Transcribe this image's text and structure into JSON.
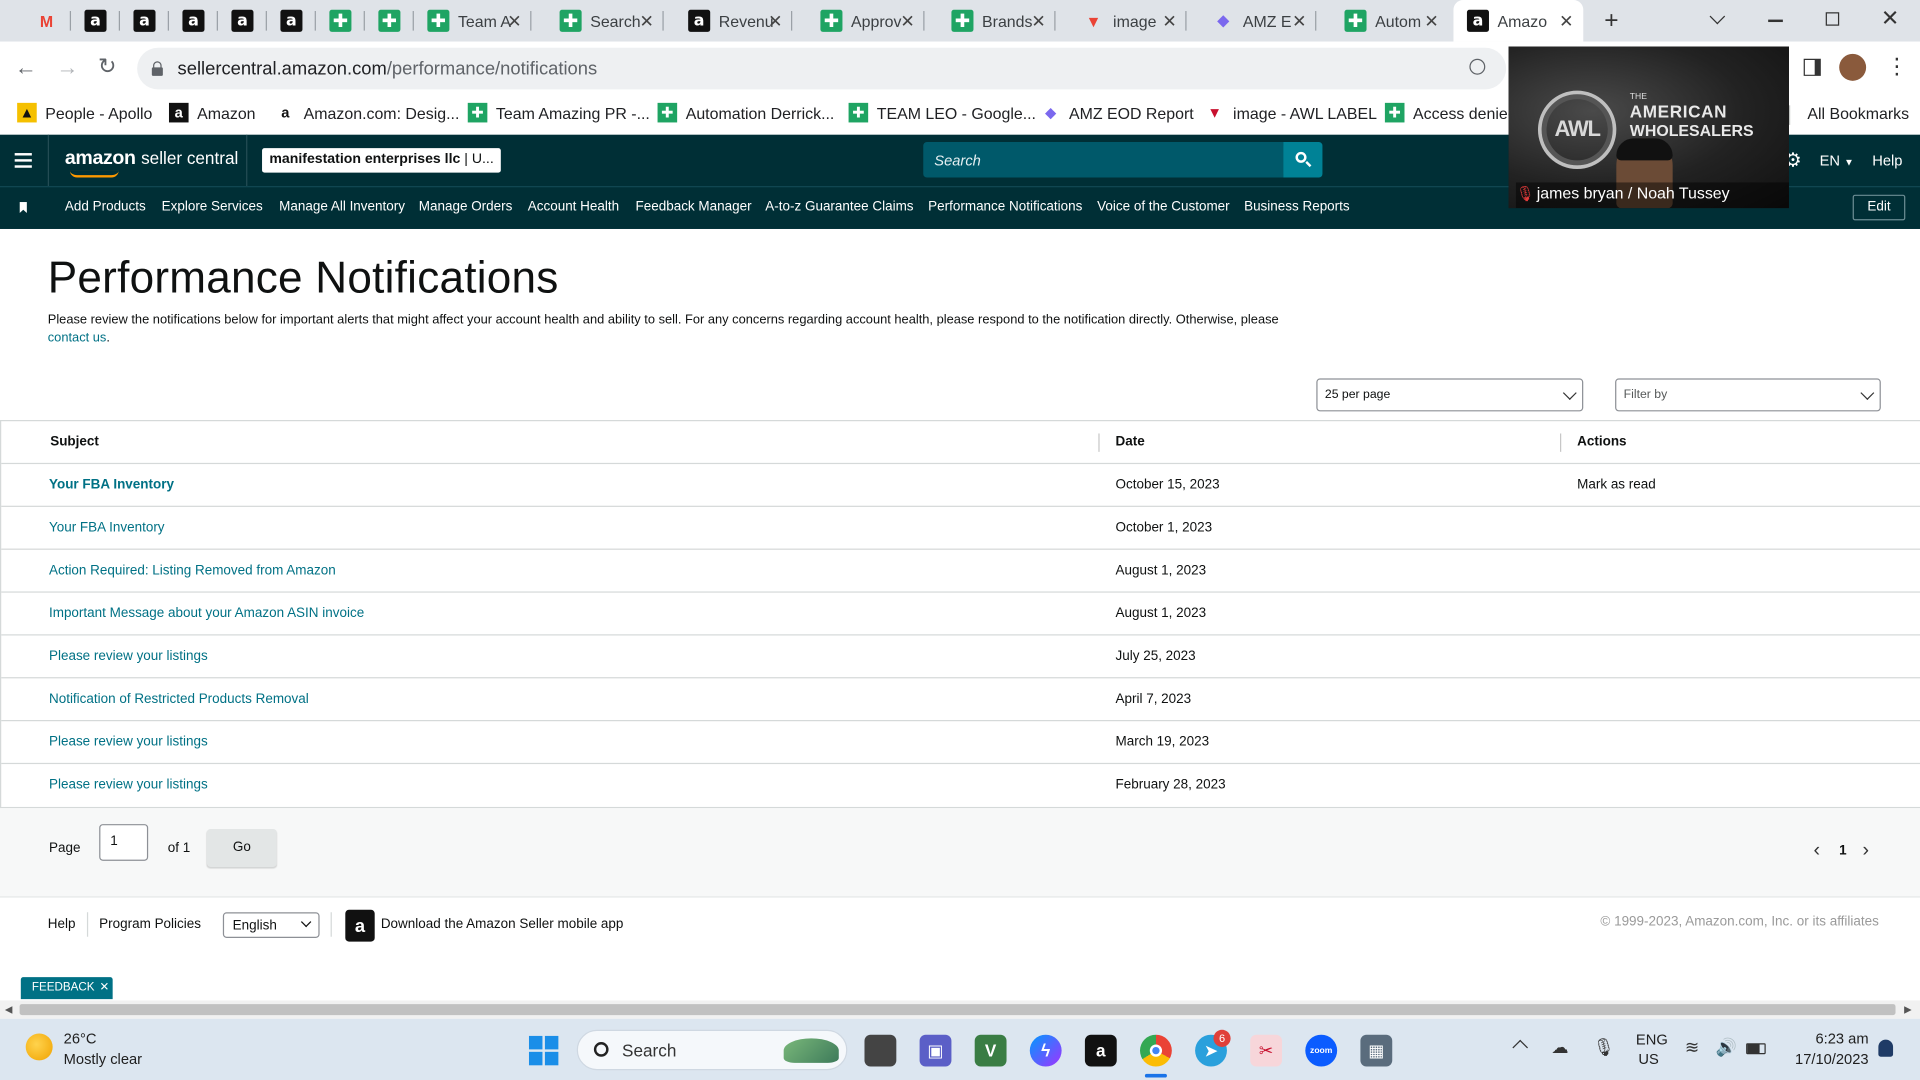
{
  "browser": {
    "tabs": [
      {
        "title": "",
        "icon": "gmail-icon"
      },
      {
        "title": "",
        "icon": "amazon-icon"
      },
      {
        "title": "",
        "icon": "amazon-icon"
      },
      {
        "title": "",
        "icon": "amazon-icon"
      },
      {
        "title": "",
        "icon": "amazon-icon"
      },
      {
        "title": "",
        "icon": "amazon-icon"
      },
      {
        "title": "",
        "icon": "sheets-icon"
      },
      {
        "title": "",
        "icon": "sheets-icon"
      },
      {
        "title": "Team A",
        "icon": "sheets-icon"
      },
      {
        "title": "Search",
        "icon": "sheets-icon"
      },
      {
        "title": "Revenu",
        "icon": "amazon-icon"
      },
      {
        "title": "Approv",
        "icon": "sheets-icon"
      },
      {
        "title": "Brands",
        "icon": "sheets-icon"
      },
      {
        "title": "image",
        "icon": "awl-icon"
      },
      {
        "title": "AMZ E",
        "icon": "clickup-icon"
      },
      {
        "title": "Autom",
        "icon": "sheets-icon"
      },
      {
        "title": "Amazo",
        "icon": "amazon-icon"
      }
    ],
    "new_tab": "+",
    "url_host": "sellercentral.amazon.com",
    "url_path": "/performance/notifications",
    "bookmarks": [
      {
        "label": "People - Apollo",
        "icon": "apollo-icon"
      },
      {
        "label": "Amazon",
        "icon": "amazon-icon"
      },
      {
        "label": "Amazon.com: Desig...",
        "icon": "amazon-smile-icon"
      },
      {
        "label": "Team Amazing PR -...",
        "icon": "sheets-icon"
      },
      {
        "label": "Automation Derrick...",
        "icon": "sheets-icon"
      },
      {
        "label": "TEAM LEO - Google...",
        "icon": "sheets-icon"
      },
      {
        "label": "AMZ EOD Report",
        "icon": "clickup-icon"
      },
      {
        "label": "image - AWL LABEL",
        "icon": "awl-icon"
      },
      {
        "label": "Access denied",
        "icon": "sheets-icon"
      }
    ],
    "all_bookmarks": "All Bookmarks"
  },
  "video": {
    "caption": "james bryan / Noah Tussey",
    "logo_the": "THE",
    "logo_line1": "AMERICAN",
    "logo_line2": "WHOLESALERS",
    "logo_mark": "AWL"
  },
  "seller_header": {
    "logo_amazon": "amazon",
    "logo_sc": "seller central",
    "account": "manifestation enterprises llc",
    "account_suffix": " | U...",
    "search_placeholder": "Search",
    "lang": "EN",
    "help": "Help"
  },
  "nav": {
    "items": [
      "Add Products",
      "Explore Services",
      "Manage All Inventory",
      "Manage Orders",
      "Account Health",
      "Feedback Manager",
      "A-to-z Guarantee Claims",
      "Performance Notifications",
      "Voice of the Customer",
      "Business Reports"
    ],
    "edit": "Edit"
  },
  "page": {
    "title": "Performance Notifications",
    "intro": "Please review the notifications below for important alerts that might affect your account health and ability to sell. For any concerns regarding account health, please respond to the notification directly. Otherwise, please ",
    "contact_link": "contact us",
    "intro_end": ".",
    "per_page": "25 per page",
    "filter_placeholder": "Filter by"
  },
  "table": {
    "headers": {
      "subject": "Subject",
      "date": "Date",
      "actions": "Actions"
    },
    "rows": [
      {
        "subject": "Your FBA Inventory",
        "date": "October 15, 2023",
        "action": "Mark as read",
        "unread": true
      },
      {
        "subject": "Your FBA Inventory",
        "date": "October 1, 2023",
        "action": "",
        "unread": false
      },
      {
        "subject": "Action Required: Listing Removed from Amazon",
        "date": "August 1, 2023",
        "action": "",
        "unread": false
      },
      {
        "subject": "Important Message about your Amazon ASIN invoice",
        "date": "August 1, 2023",
        "action": "",
        "unread": false
      },
      {
        "subject": "Please review your listings",
        "date": "July 25, 2023",
        "action": "",
        "unread": false
      },
      {
        "subject": "Notification of Restricted Products Removal",
        "date": "April 7, 2023",
        "action": "",
        "unread": false
      },
      {
        "subject": "Please review your listings",
        "date": "March 19, 2023",
        "action": "",
        "unread": false
      },
      {
        "subject": "Please review your listings",
        "date": "February 28, 2023",
        "action": "",
        "unread": false
      }
    ]
  },
  "pager": {
    "page_label": "Page",
    "page_value": "1",
    "of_label": "of 1",
    "go": "Go",
    "current": "1",
    "prev": "‹",
    "next": "›"
  },
  "footer": {
    "help": "Help",
    "policies": "Program Policies",
    "language": "English",
    "app": "Download the Amazon Seller mobile app",
    "copyright": "© 1999-2023, Amazon.com, Inc. or its affiliates",
    "feedback": "FEEDBACK"
  },
  "taskbar": {
    "temp": "26°C",
    "weather": "Mostly clear",
    "search": "Search",
    "lang1": "ENG",
    "lang2": "US",
    "time": "6:23 am",
    "date": "17/10/2023",
    "telegram_badge": "6"
  },
  "colors": {
    "header": "#002f36",
    "link": "#007185",
    "search_button": "#008296"
  }
}
